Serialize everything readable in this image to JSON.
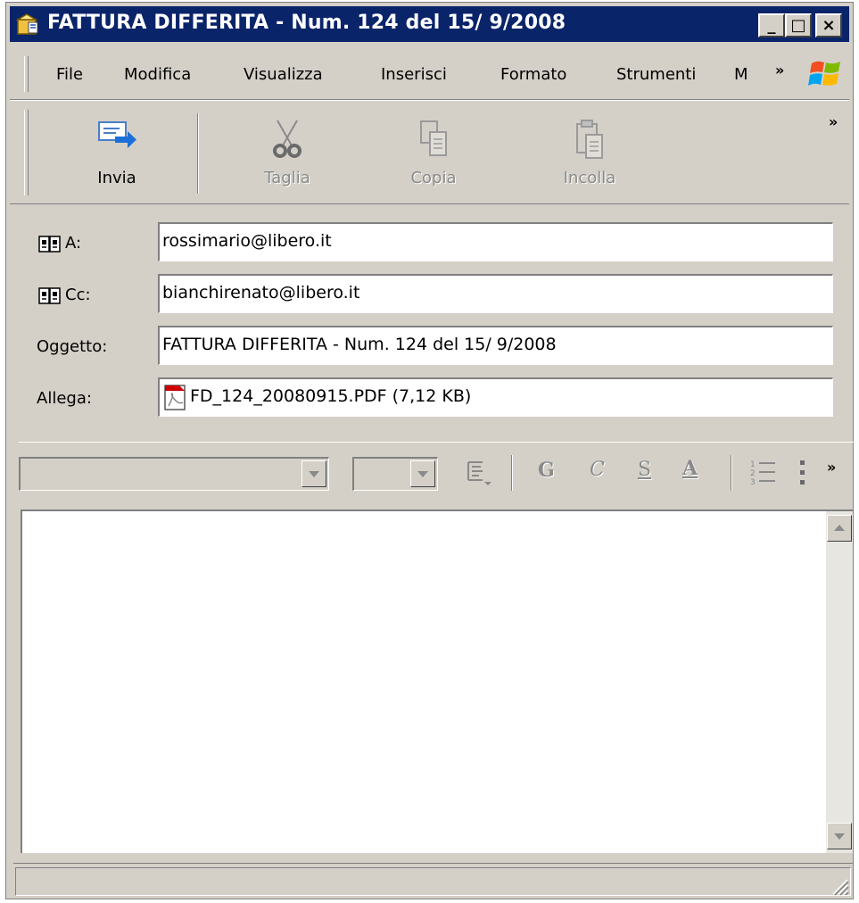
{
  "window": {
    "title": "FATTURA DIFFERITA - Num. 124 del 15/ 9/2008",
    "controls": {
      "minimize": "_",
      "maximize": "□",
      "close": "×"
    }
  },
  "menubar": {
    "items": [
      "File",
      "Modifica",
      "Visualizza",
      "Inserisci",
      "Formato",
      "Strumenti",
      "M"
    ],
    "overflow": "»"
  },
  "toolbar": {
    "buttons": [
      {
        "label": "Invia",
        "icon": "send-icon",
        "enabled": true
      },
      {
        "label": "Taglia",
        "icon": "scissors-icon",
        "enabled": false
      },
      {
        "label": "Copia",
        "icon": "copy-icon",
        "enabled": false
      },
      {
        "label": "Incolla",
        "icon": "paste-icon",
        "enabled": false
      }
    ],
    "overflow": "»"
  },
  "fields": {
    "to": {
      "label": "A:",
      "value": "rossimario@libero.it"
    },
    "cc": {
      "label": "Cc:",
      "value": "bianchirenato@libero.it"
    },
    "subject": {
      "label": "Oggetto:",
      "value": "FATTURA DIFFERITA - Num. 124 del 15/ 9/2008"
    },
    "attach": {
      "label": "Allega:",
      "value": "FD_124_20080915.PDF (7,12 KB)",
      "icon": "pdf-file-icon"
    }
  },
  "format": {
    "font_value": "",
    "size_value": "",
    "bold": "G",
    "italic": "C",
    "underline": "S",
    "color": "A",
    "overflow": "»"
  },
  "colors": {
    "titlebar": "#0a246a",
    "face": "#d4d0c8",
    "send_arrow": "#1c6fd6",
    "pdf_red": "#cc0000"
  }
}
